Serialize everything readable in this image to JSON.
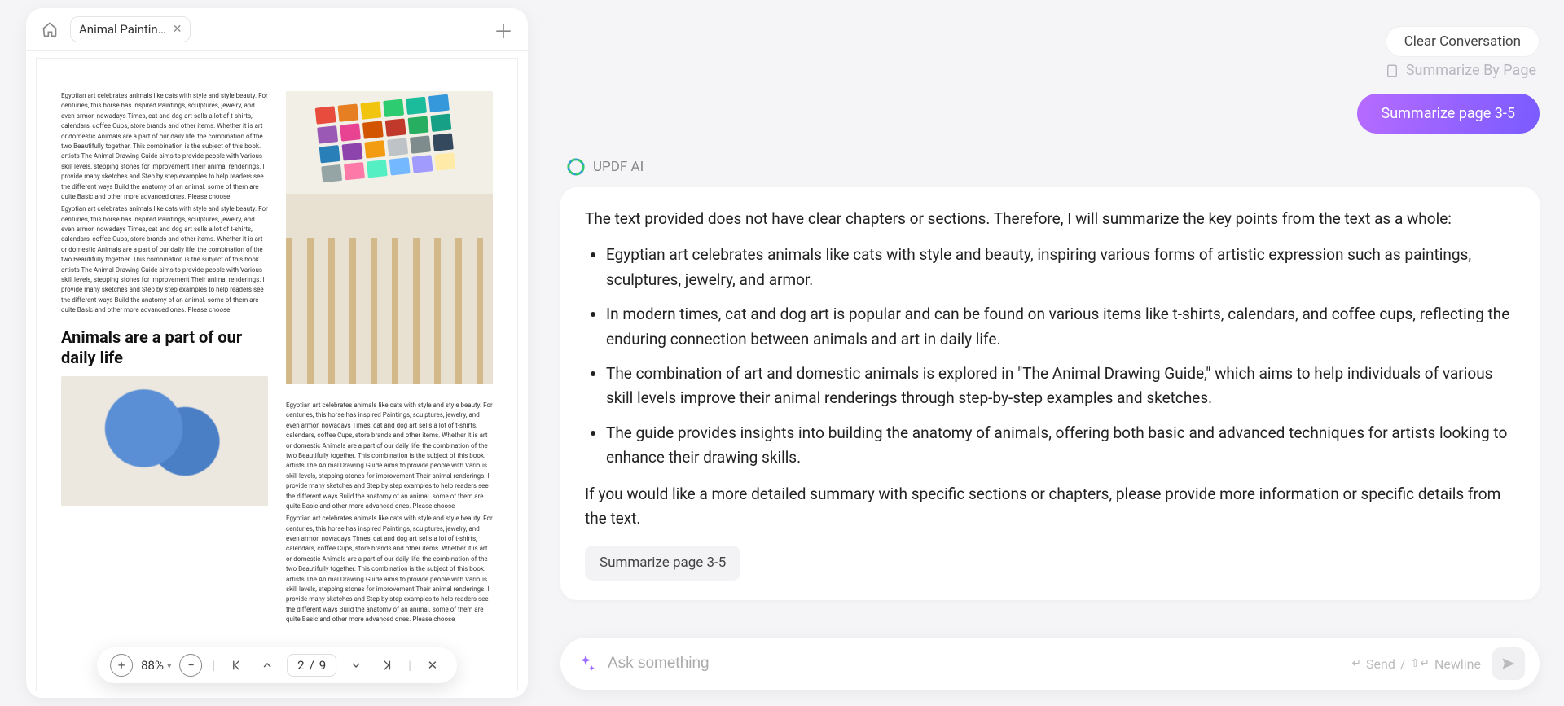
{
  "tab": {
    "title": "Animal Paintin…"
  },
  "toolbar": {
    "zoom": "88%",
    "page_current": "2",
    "page_sep": "/",
    "page_total": "9"
  },
  "doc": {
    "heading": "Animals are a part of our daily life",
    "para": "Egyptian art celebrates animals like cats with style and style beauty. For centuries, this horse has inspired Paintings, sculptures, jewelry, and even armor. nowadays Times, cat and dog art sells a lot of t-shirts, calendars, coffee Cups, store brands and other items. Whether it is art or domestic Animals are a part of our daily life, the combination of the two Beautifully together. This combination is the subject of this book. artists The Animal Drawing Guide aims to provide people with Various skill levels, stepping stones for improvement Their animal renderings. I provide many sketches and Step by step examples to help readers see the different ways Build the anatomy of an animal. some of them are quite Basic and other more advanced ones. Please choose"
  },
  "right": {
    "clear": "Clear Conversation",
    "summ_by_page": "Summarize By Page",
    "summ_pill": "Summarize page 3-5",
    "ai_label": "UPDF AI",
    "intro": "The text provided does not have clear chapters or sections. Therefore, I will summarize the key points from the text as a whole:",
    "bullets": [
      "Egyptian art celebrates animals like cats with style and beauty, inspiring various forms of artistic expression such as paintings, sculptures, jewelry, and armor.",
      "In modern times, cat and dog art is popular and can be found on various items like t-shirts, calendars, and coffee cups, reflecting the enduring connection between animals and art in daily life.",
      "The combination of art and domestic animals is explored in \"The Animal Drawing Guide,\" which aims to help individuals of various skill levels improve their animal renderings through step-by-step examples and sketches.",
      "The guide provides insights into building the anatomy of animals, offering both basic and advanced techniques for artists looking to enhance their drawing skills."
    ],
    "outro": "If you would like a more detailed summary with specific sections or chapters, please provide more information or specific details from the text.",
    "chip": "Summarize page 3-5",
    "placeholder": "Ask something",
    "hint_send": "Send",
    "hint_sep": "/",
    "hint_newline": "Newline"
  },
  "palette_colors": [
    "#e74c3c",
    "#e67e22",
    "#f1c40f",
    "#2ecc71",
    "#1abc9c",
    "#3498db",
    "#9b59b6",
    "#e84393",
    "#d35400",
    "#c0392b",
    "#27ae60",
    "#16a085",
    "#2980b9",
    "#8e44ad",
    "#f39c12",
    "#bdc3c7",
    "#7f8c8d",
    "#34495e",
    "#95a5a6",
    "#fd79a8",
    "#55efc4",
    "#74b9ff",
    "#a29bfe",
    "#ffeaa7"
  ]
}
